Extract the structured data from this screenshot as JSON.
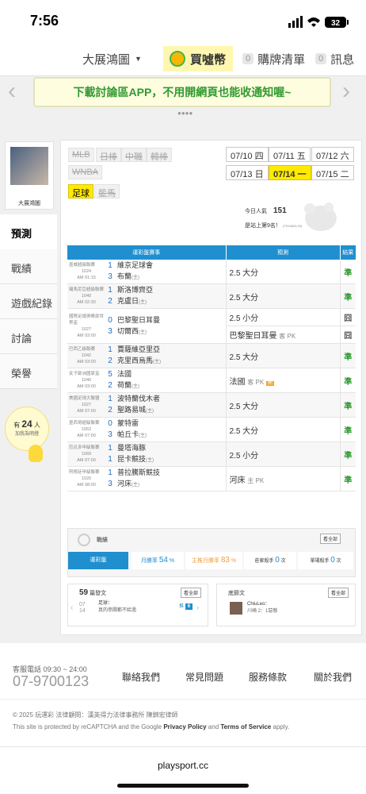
{
  "status": {
    "time": "7:56",
    "battery": "32"
  },
  "nav": {
    "user": "大展鴻圖",
    "buy": "買噓幣",
    "cart_count": "0",
    "cart": "購牌清單",
    "msg_count": "0",
    "msg": "訊息"
  },
  "banner": {
    "text": "下載討論區APP，不用開網頁也能收通知喔~"
  },
  "sidebar": {
    "username": "大展鴻圖",
    "items": [
      "預測",
      "戰績",
      "遊戲紀錄",
      "討論",
      "榮譽"
    ],
    "count_pre": "有",
    "count": "24",
    "count_post": "人",
    "count_sub": "加我為明燈"
  },
  "sports": [
    "MLB",
    "日棒",
    "中職",
    "韓棒",
    "WNBA",
    "足球",
    "籃馬"
  ],
  "dates": [
    "07/10 四",
    "07/11 五",
    "07/12 六",
    "07/13 日",
    "07/14 一",
    "07/15 二"
  ],
  "pop": {
    "label": "今日人氣",
    "value": "151",
    "rank": "是站上第9名！",
    "rank_small": "(TS18826.93)"
  },
  "table": {
    "head_match": "運彩盤賽事",
    "head_pred": "預測",
    "head_res": "結果"
  },
  "matches": [
    {
      "league": "墨威超級聯賽",
      "code": "1024",
      "time": "AM 01:15",
      "s1": "1",
      "t1": "維京足球會",
      "s2": "3",
      "t2": "布蘭",
      "t2s": "(主)",
      "preds": [
        {
          "p": "2.5 大分",
          "r": "準",
          "rc": "ok"
        }
      ]
    },
    {
      "league": "羅馬尼亞超級聯賽",
      "code": "1040",
      "time": "AM 02:30",
      "s1": "1",
      "t1": "斯洛博齊亞",
      "s2": "2",
      "t2": "克盧日",
      "t2s": "(主)",
      "preds": [
        {
          "p": "2.5 大分",
          "r": "準",
          "rc": "ok"
        }
      ]
    },
    {
      "league": "國際足總俱樂部世界盃",
      "code": "1027",
      "time": "AM 03:00",
      "s1": "0",
      "t1": "巴黎聖日耳曼",
      "s2": "3",
      "t2": "切爾西",
      "t2s": "(主)",
      "preds": [
        {
          "p": "2.5 小分",
          "r": "囧",
          "rc": "lose"
        },
        {
          "p": "巴黎聖日耳曼",
          "ps": "客 PK",
          "r": "囧",
          "rc": "lose"
        }
      ]
    },
    {
      "league": "巴西乙級聯賽",
      "code": "1042",
      "time": "AM 03:00",
      "s1": "1",
      "t1": "賈薩維亞里亞",
      "s2": "2",
      "t2": "克里西烏馬",
      "t2s": "(主)",
      "preds": [
        {
          "p": "2.5 大分",
          "r": "準",
          "rc": "ok"
        }
      ]
    },
    {
      "league": "女子歐洲國家盃",
      "code": "1040",
      "time": "AM 03:00",
      "s1": "5",
      "t1": "法國",
      "s2": "2",
      "t2": "荷蘭",
      "t2s": "(主)",
      "preds": [
        {
          "p": "法國",
          "ps": "客 PK",
          "r": "準",
          "rc": "ok",
          "hot": "熱"
        }
      ]
    },
    {
      "league": "美國足球大聯盟",
      "code": "1027",
      "time": "AM 07:00",
      "s1": "1",
      "t1": "波特蘭伐木者",
      "s2": "2",
      "t2": "聖路易城",
      "t2s": "(主)",
      "preds": [
        {
          "p": "2.5 大分",
          "r": "準",
          "rc": "ok"
        }
      ]
    },
    {
      "league": "墨西哥超級聯賽",
      "code": "1053",
      "time": "AM 07:00",
      "s1": "0",
      "t1": "蒙特雷",
      "s2": "3",
      "t2": "帕丘卡",
      "t2s": "(主)",
      "preds": [
        {
          "p": "2.5 大分",
          "r": "準",
          "rc": "ok"
        }
      ]
    },
    {
      "league": "厄瓜多甲級聯賽",
      "code": "1069",
      "time": "AM 07:00",
      "s1": "1",
      "t1": "曼塔海豚",
      "s2": "1",
      "t2": "昆卡競技",
      "t2s": "(主)",
      "preds": [
        {
          "p": "2.5 小分",
          "r": "準",
          "rc": "ok"
        }
      ]
    },
    {
      "league": "阿根廷甲級聯賽",
      "code": "1020",
      "time": "AM 08:00",
      "s1": "1",
      "t1": "普拉騰斯競技",
      "s2": "3",
      "t2": "河床",
      "t2s": "(主)",
      "preds": [
        {
          "p": "河床",
          "ps": "主 PK",
          "r": "準",
          "rc": "ok"
        }
      ]
    }
  ],
  "record": {
    "title": "戰績",
    "all": "看全部",
    "tab": "運彩盤",
    "month": "月勝率",
    "month_val": "54",
    "unit": "%",
    "host": "主推月勝率",
    "host_val": "83",
    "away": "莊家殺手",
    "away_val": "0",
    "away_unit": "次",
    "single": "單場殺手",
    "single_val": "0",
    "single_unit": "次"
  },
  "posts": {
    "count": "59",
    "label": "篇發文",
    "all": "看全部",
    "date_m": "07",
    "date_d": "14",
    "post_title": "足球：",
    "post_text": "真的串關都不給過",
    "push": "推",
    "push_val": "6"
  },
  "fans": {
    "label": "底節文",
    "all": "看全部",
    "name": "ChiuLeo：",
    "text": "川崎 2：1惡態"
  },
  "footer": {
    "phone_label": "客服電話 09:30 ~ 24:00",
    "phone": "07-9700123",
    "links": [
      "聯絡我們",
      "常見問題",
      "服務條款",
      "關於我們"
    ],
    "copyright": "© 2025 玩運彩 法律顧問：漢英得力法律事務所 陳錦宏律師",
    "recaptcha": "This site is protected by reCAPTCHA and the Google ",
    "pp": "Privacy Policy",
    "and": " and ",
    "tos": "Terms of Service",
    "apply": " apply.",
    "domain": "playsport.cc"
  },
  "colors": {
    "accent": "#1f8fcf",
    "win": "#2e9a2e",
    "selected": "#ffea00"
  }
}
